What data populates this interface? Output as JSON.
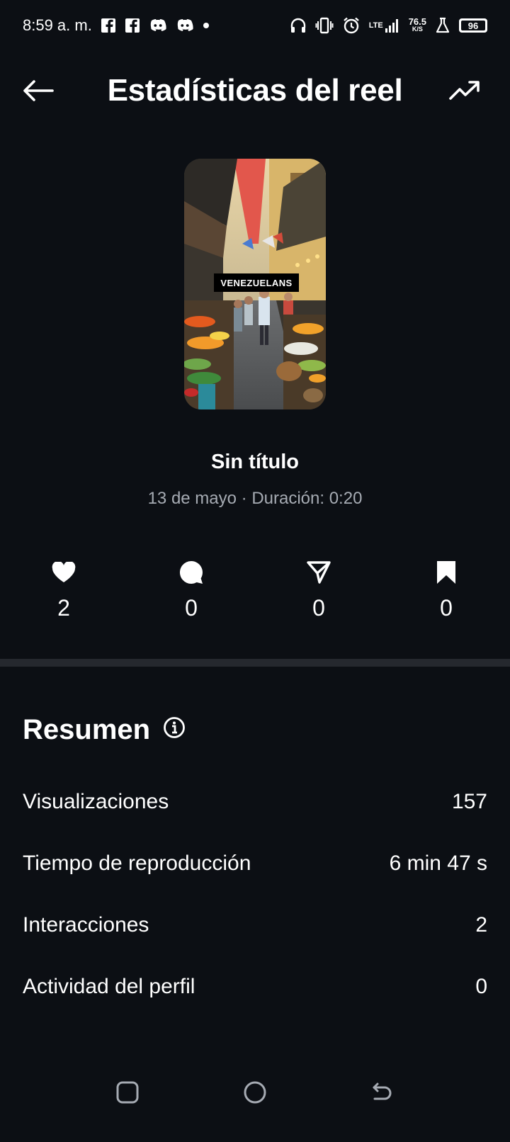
{
  "status_bar": {
    "time": "8:59 a. m.",
    "network_type": "LTE",
    "speed_value": "76.5",
    "speed_unit": "K/S",
    "battery": "96"
  },
  "header": {
    "title": "Estadísticas del reel"
  },
  "reel": {
    "overlay_text": "VENEZUELANS",
    "title": "Sin título",
    "meta": "13 de mayo · Duración: 0:20"
  },
  "engagement": {
    "likes": "2",
    "comments": "0",
    "shares": "0",
    "saves": "0"
  },
  "summary": {
    "title": "Resumen",
    "rows": [
      {
        "label": "Visualizaciones",
        "value": "157"
      },
      {
        "label": "Tiempo de reproducción",
        "value": "6 min 47 s"
      },
      {
        "label": "Interacciones",
        "value": "2"
      },
      {
        "label": "Actividad del perfil",
        "value": "0"
      }
    ]
  },
  "colors": {
    "background": "#0c0f14",
    "text": "#ffffff",
    "muted_text": "#a6abb3",
    "divider": "#25282e"
  }
}
